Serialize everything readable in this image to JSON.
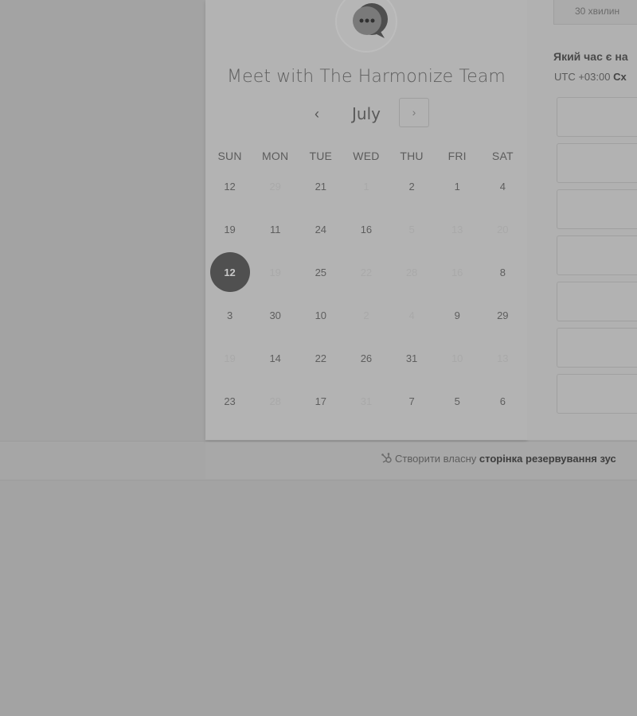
{
  "calendar": {
    "title": "Meet with The Harmonize Team",
    "month": "July",
    "prev_label": "‹",
    "next_label": "›",
    "weekdays": [
      "SUN",
      "MON",
      "TUE",
      "WED",
      "THU",
      "FRI",
      "SAT"
    ],
    "weeks": [
      [
        {
          "d": "12",
          "dis": false
        },
        {
          "d": "29",
          "dis": true
        },
        {
          "d": "21",
          "dis": false
        },
        {
          "d": "1",
          "dis": true
        },
        {
          "d": "2",
          "dis": false
        },
        {
          "d": "1",
          "dis": false
        },
        {
          "d": "4",
          "dis": false
        }
      ],
      [
        {
          "d": "19",
          "dis": false
        },
        {
          "d": "11",
          "dis": false
        },
        {
          "d": "24",
          "dis": false
        },
        {
          "d": "16",
          "dis": false
        },
        {
          "d": "5",
          "dis": true
        },
        {
          "d": "13",
          "dis": true
        },
        {
          "d": "20",
          "dis": true
        }
      ],
      [
        {
          "d": "12",
          "dis": false,
          "sel": true
        },
        {
          "d": "19",
          "dis": true
        },
        {
          "d": "25",
          "dis": false
        },
        {
          "d": "22",
          "dis": true
        },
        {
          "d": "28",
          "dis": true
        },
        {
          "d": "16",
          "dis": true
        },
        {
          "d": "8",
          "dis": false
        }
      ],
      [
        {
          "d": "3",
          "dis": false
        },
        {
          "d": "30",
          "dis": false
        },
        {
          "d": "10",
          "dis": false
        },
        {
          "d": "2",
          "dis": true
        },
        {
          "d": "4",
          "dis": true
        },
        {
          "d": "9",
          "dis": false
        },
        {
          "d": "29",
          "dis": false
        }
      ],
      [
        {
          "d": "19",
          "dis": true
        },
        {
          "d": "14",
          "dis": false
        },
        {
          "d": "22",
          "dis": false
        },
        {
          "d": "26",
          "dis": false
        },
        {
          "d": "31",
          "dis": false
        },
        {
          "d": "10",
          "dis": true
        },
        {
          "d": "13",
          "dis": true
        }
      ],
      [
        {
          "d": "23",
          "dis": false
        },
        {
          "d": "28",
          "dis": true
        },
        {
          "d": "17",
          "dis": false
        },
        {
          "d": "31",
          "dis": true
        },
        {
          "d": "7",
          "dis": false
        },
        {
          "d": "5",
          "dis": false
        },
        {
          "d": "6",
          "dis": false
        }
      ]
    ]
  },
  "booking": {
    "duration": "30 хвилин",
    "question": "Який час є на",
    "tz_offset": "UTC +03:00",
    "tz_name": "Сх",
    "slot_count": 7
  },
  "footer": {
    "prefix": "Створити власну",
    "bold": "сторінка резервування зус"
  },
  "colors": {
    "selected": "#505050",
    "overlay": "#a3a3a3"
  },
  "icons": {
    "avatar": "chat-bubble-icon",
    "footer": "sprocket-icon"
  }
}
